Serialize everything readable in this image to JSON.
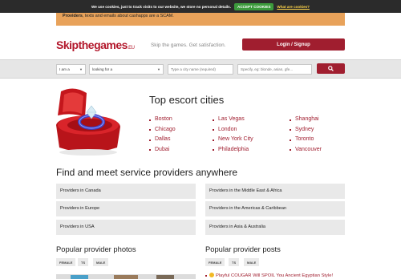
{
  "cookie_bar": {
    "text": "We use cookies, just to track visits to our website, we store no personal details.",
    "accept_label": "ACCEPT COOKIES",
    "link_label": "What are cookies?"
  },
  "notice": {
    "bold": "Providers",
    "text": ", texts and emails about cashapps are a SCAM."
  },
  "header": {
    "logo": "Skipthegames",
    "logo_suffix": ".EU",
    "tagline": "Skip the games. Get satisfaction.",
    "login_label": "Login / Signup"
  },
  "search": {
    "iam_value": "I am a",
    "lookingfor_value": "looking for a",
    "city_placeholder": "Type a city name (required)",
    "specify_placeholder": "Specify, eg: blonde, asian, gfe..."
  },
  "top_cities": {
    "title": "Top escort cities",
    "col1": [
      "Boston",
      "Chicago",
      "Dallas",
      "Dubai"
    ],
    "col2": [
      "Las Vegas",
      "London",
      "New York City",
      "Philadelphia"
    ],
    "col3": [
      "Shanghai",
      "Sydney",
      "Toronto",
      "Vancouver"
    ]
  },
  "find": {
    "title": "Find and meet service providers anywhere",
    "regions": [
      "Providers in Canada",
      "Providers in the Middle East & Africa",
      "Providers in Europe",
      "Providers in the Americas & Caribbean",
      "Providers in USA",
      "Providers in Asia & Australia"
    ]
  },
  "photos": {
    "title": "Popular provider photos",
    "filters": [
      "FEMALE",
      "TS",
      "MALE"
    ]
  },
  "posts": {
    "title": "Popular provider posts",
    "filters": [
      "FEMALE",
      "TS",
      "MALE"
    ],
    "items": [
      "Playful COUGAR Will SPOIL You Ancient Egyptian Style!"
    ]
  },
  "colors": {
    "brand": "#a01e2f",
    "notice": "#e8a25a",
    "cookie_bar": "#2b2b2b",
    "accept": "#3c9a3c"
  }
}
